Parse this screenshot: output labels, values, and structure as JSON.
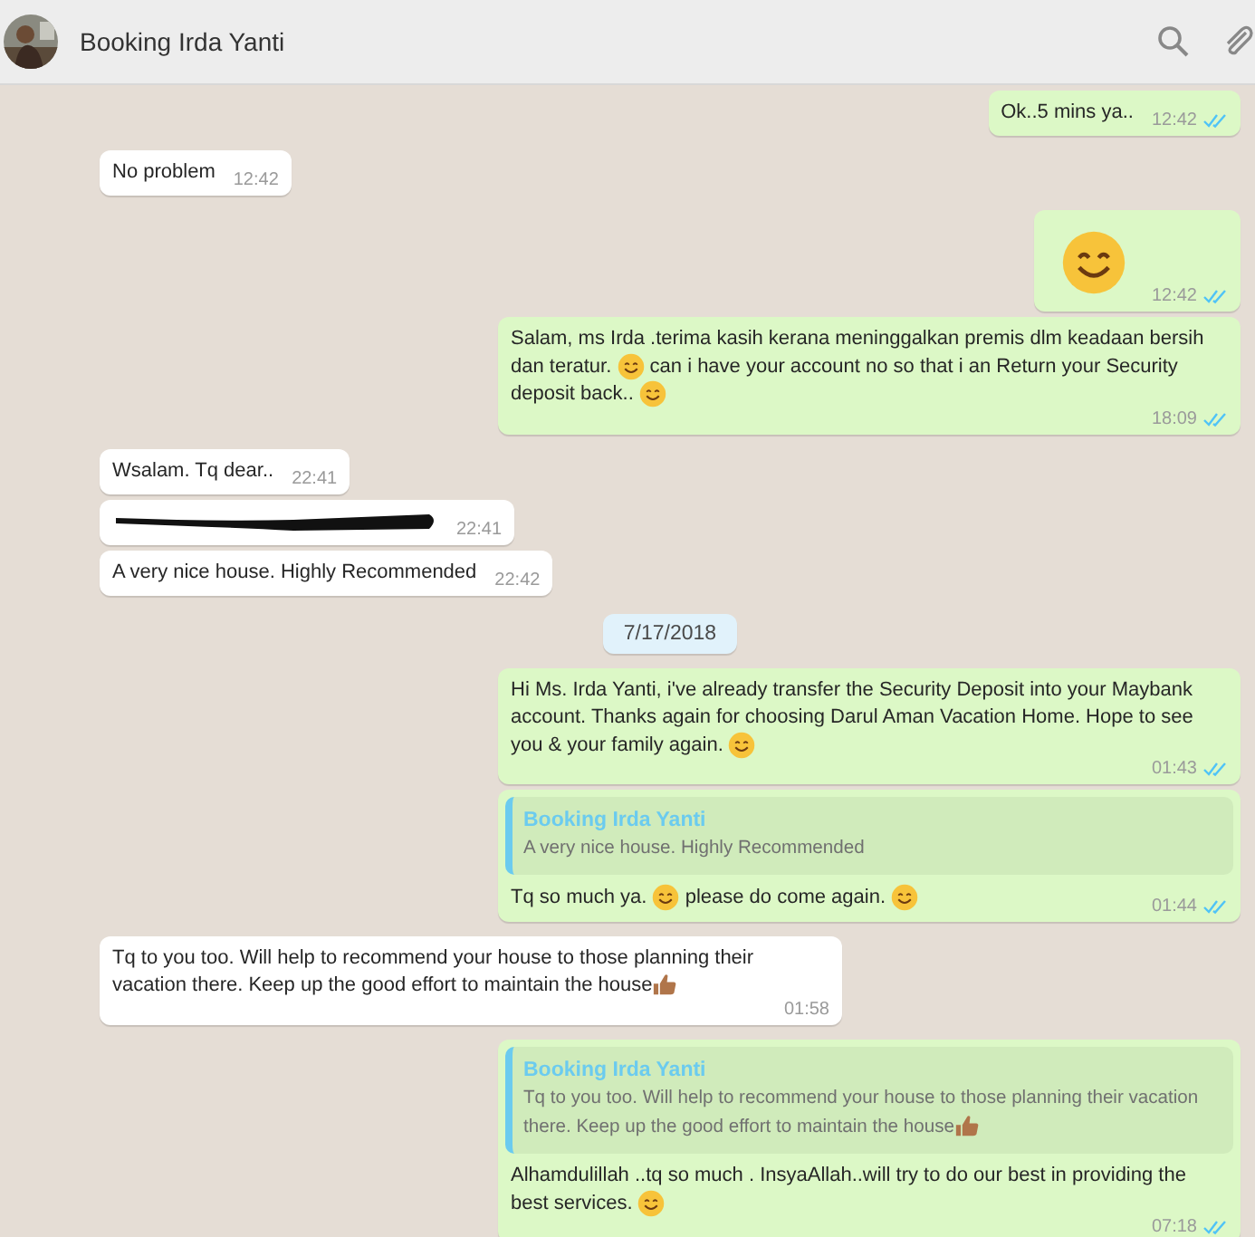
{
  "header": {
    "title": "Booking Irda Yanti"
  },
  "messages": [
    {
      "kind": "out",
      "parts": [
        {
          "kind": "text",
          "text": "Ok..5 mins ya.."
        }
      ],
      "time": "12:42",
      "read": true
    },
    {
      "kind": "in",
      "parts": [
        {
          "kind": "text",
          "text": "No problem"
        }
      ],
      "time": "12:42"
    },
    {
      "kind": "out",
      "parts": [
        {
          "kind": "big_smile"
        }
      ],
      "time": "12:42",
      "read": true
    },
    {
      "kind": "out",
      "parts": [
        {
          "kind": "text",
          "text": "Salam, ms Irda .terima kasih kerana meninggalkan premis dlm keadaan bersih dan teratur. "
        },
        {
          "kind": "smile"
        },
        {
          "kind": "text",
          "text": " can i have your account no so that i an Return your Security deposit back.. "
        },
        {
          "kind": "smile"
        }
      ],
      "time": "18:09",
      "read": true
    },
    {
      "kind": "in",
      "parts": [
        {
          "kind": "text",
          "text": "Wsalam. Tq dear.."
        }
      ],
      "time": "22:41"
    },
    {
      "kind": "in",
      "parts": [
        {
          "kind": "redacted"
        }
      ],
      "time": "22:41"
    },
    {
      "kind": "in",
      "parts": [
        {
          "kind": "text",
          "text": "A very nice house. Highly Recommended"
        }
      ],
      "time": "22:42"
    },
    {
      "kind": "date",
      "label": "7/17/2018"
    },
    {
      "kind": "out",
      "parts": [
        {
          "kind": "text",
          "text": "Hi Ms. Irda Yanti, i've already transfer the Security Deposit into your Maybank account. Thanks again for choosing Darul Aman Vacation Home. Hope to see you & your family again. "
        },
        {
          "kind": "smile"
        }
      ],
      "time": "01:43",
      "read": true
    },
    {
      "kind": "out",
      "quote": {
        "author": "Booking Irda Yanti",
        "parts": [
          {
            "kind": "text",
            "text": "A very nice house. Highly Recommended"
          }
        ]
      },
      "parts": [
        {
          "kind": "text",
          "text": "Tq so much ya. "
        },
        {
          "kind": "smile"
        },
        {
          "kind": "text",
          "text": " please do come again. "
        },
        {
          "kind": "smile"
        }
      ],
      "time": "01:44",
      "read": true
    },
    {
      "kind": "in",
      "parts": [
        {
          "kind": "text",
          "text": "Tq to you too. Will help to recommend your house to those planning their vacation there. Keep up the good effort to maintain the house"
        },
        {
          "kind": "thumb"
        }
      ],
      "time": "01:58"
    },
    {
      "kind": "out",
      "quote": {
        "author": "Booking Irda Yanti",
        "parts": [
          {
            "kind": "text",
            "text": "Tq to you too. Will help to recommend your house to those planning their vacation there. Keep up the good effort to maintain the house"
          },
          {
            "kind": "thumb"
          }
        ]
      },
      "parts": [
        {
          "kind": "text",
          "text": "Alhamdulillah ..tq so much . InsyaAllah..will try to do our best in providing the best services. "
        },
        {
          "kind": "smile"
        }
      ],
      "time": "07:18",
      "read": true
    }
  ]
}
